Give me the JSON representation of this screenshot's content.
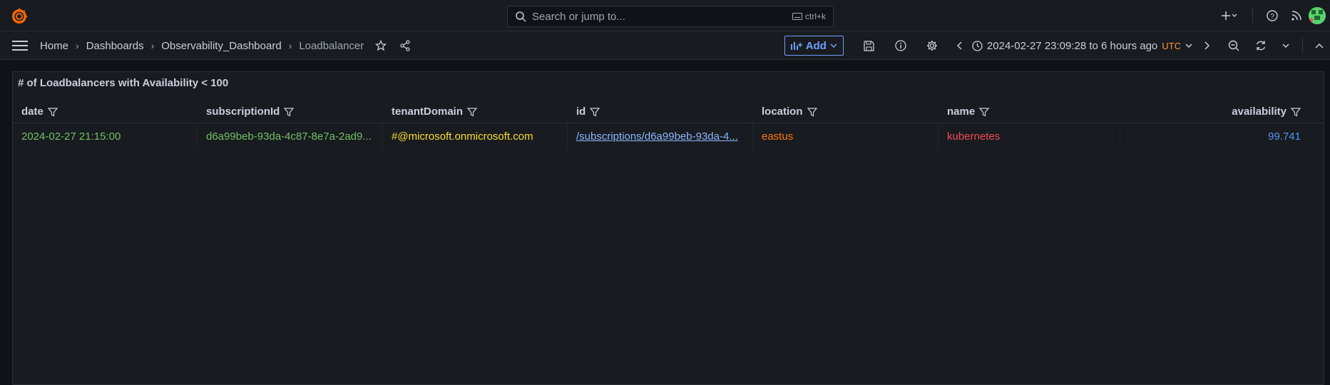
{
  "topbar": {
    "search_placeholder": "Search or jump to...",
    "shortcut": "ctrl+k"
  },
  "breadcrumb": {
    "home": "Home",
    "dashboards": "Dashboards",
    "folder": "Observability_Dashboard",
    "current": "Loadbalancer",
    "separator": "›"
  },
  "toolbar": {
    "add_label": "Add",
    "time_range": "2024-02-27 23:09:28 to 6 hours ago",
    "timezone": "UTC"
  },
  "panel": {
    "title": "# of Loadbalancers with Availability < 100",
    "columns": [
      "date",
      "subscriptionId",
      "tenantDomain",
      "id",
      "location",
      "name",
      "availability"
    ],
    "rows": [
      {
        "date": "2024-02-27 21:15:00",
        "subscriptionId": "d6a99beb-93da-4c87-8e7a-2ad9...",
        "tenantDomain": "#@microsoft.onmicrosoft.com",
        "id": "/subscriptions/d6a99beb-93da-4...",
        "location": "eastus",
        "name": "kubernetes",
        "availability": "99.741"
      }
    ]
  },
  "colors": {
    "date": "#73bf69",
    "subscriptionId": "#73bf69",
    "tenantDomain": "#fade2a",
    "id": "#8ab8ff",
    "location": "#ff780a",
    "name": "#f2495c",
    "availability": "#5794f2",
    "accent": "#6e9fff"
  }
}
